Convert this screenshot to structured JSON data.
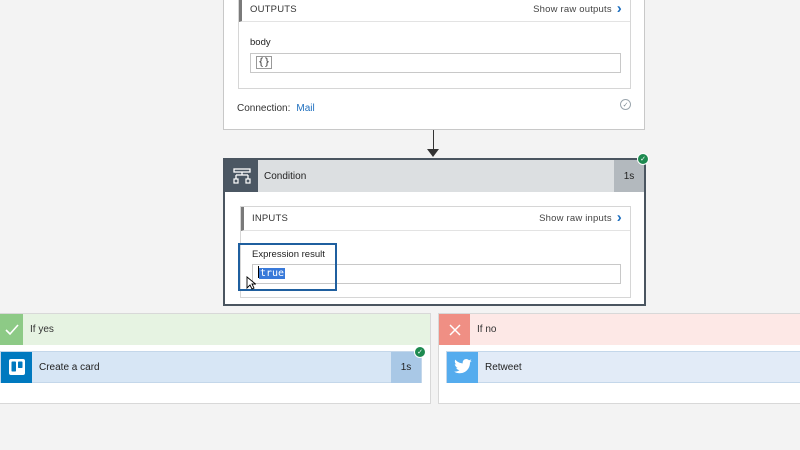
{
  "mail_step": {
    "outputs_header": "OUTPUTS",
    "show_raw_outputs": "Show raw outputs",
    "body_label": "body",
    "body_value": "{}",
    "connection_label": "Connection:",
    "connection_value": "Mail"
  },
  "condition_step": {
    "title": "Condition",
    "duration": "1s",
    "inputs_header": "INPUTS",
    "show_raw_inputs": "Show raw inputs",
    "expression_label": "Expression result",
    "expression_value": "true",
    "status": "succeeded"
  },
  "branches": {
    "yes": {
      "title": "If yes",
      "action": {
        "label": "Create a card",
        "duration": "1s",
        "icon": "trello-icon",
        "status": "succeeded"
      }
    },
    "no": {
      "title": "If no",
      "action": {
        "label": "Retweet",
        "icon": "twitter-icon"
      }
    }
  },
  "colors": {
    "accent_blue": "#1e6fbf",
    "success_green": "#1e8a50",
    "yes_green": "#8dca86",
    "no_red": "#f08f84",
    "trello_blue": "#0079bf",
    "twitter_blue": "#55acee"
  }
}
